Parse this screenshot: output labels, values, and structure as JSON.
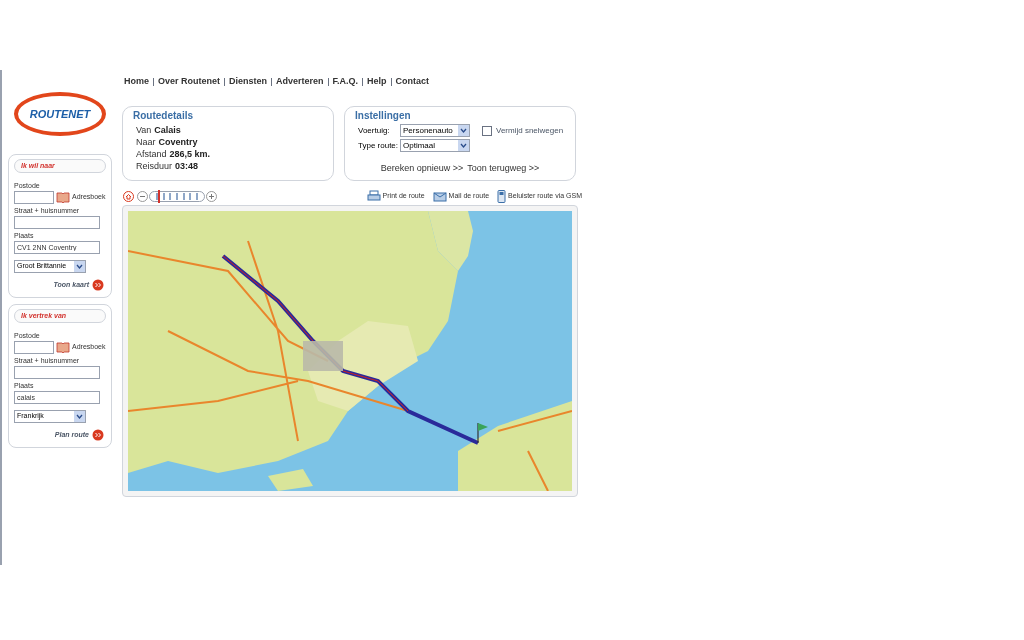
{
  "nav": [
    "Home",
    "Over Routenet",
    "Diensten",
    "Adverteren",
    "F.A.Q.",
    "Help",
    "Contact"
  ],
  "logo": "ROUTENET",
  "destination": {
    "heading": "Ik wil naar",
    "fields": [
      {
        "kind": "postcode",
        "label": "Postode",
        "link": "Adresboek"
      },
      {
        "kind": "text",
        "label": "Straat + huisnummer"
      },
      {
        "kind": "text",
        "label": "Plaats",
        "value": "CV1 2NN Coventry"
      },
      {
        "kind": "select",
        "value": "Groot Brittannie"
      }
    ],
    "action": "Toon kaart"
  },
  "origin": {
    "heading": "Ik vertrek van",
    "fields": [
      {
        "kind": "postcode",
        "label": "Postode",
        "link": "Adresboek"
      },
      {
        "kind": "text",
        "label": "Straat + huisnummer"
      },
      {
        "kind": "text",
        "label": "Plaats",
        "value": "calais"
      },
      {
        "kind": "select",
        "value": "Frankrijk"
      }
    ],
    "action": "Plan route"
  },
  "routedetails": {
    "title": "Routedetails",
    "rows": [
      {
        "label": "Van",
        "value": "Calais"
      },
      {
        "label": "Naar",
        "value": "Coventry"
      },
      {
        "label": "Afstand",
        "value": "286,5 km."
      },
      {
        "label": "Reisduur",
        "value": "03:48"
      }
    ]
  },
  "settings": {
    "title": "Instellingen",
    "vehicle_label": "Voertuig:",
    "vehicle": "Personenauto",
    "type_label": "Type route:",
    "type": "Optimaal",
    "avoid_motorways": {
      "label": "Vermijd snelwegen",
      "checked": false
    },
    "links": [
      "Bereken opnieuw >>",
      "Toon terugweg >>"
    ]
  },
  "map_toolbar": {
    "zoom": {
      "level": 0.15
    },
    "actions": [
      {
        "kind": "print",
        "label": "Print de route"
      },
      {
        "kind": "mail",
        "label": "Mail de route"
      },
      {
        "kind": "phone",
        "label": "Beluister route via GSM"
      }
    ]
  }
}
